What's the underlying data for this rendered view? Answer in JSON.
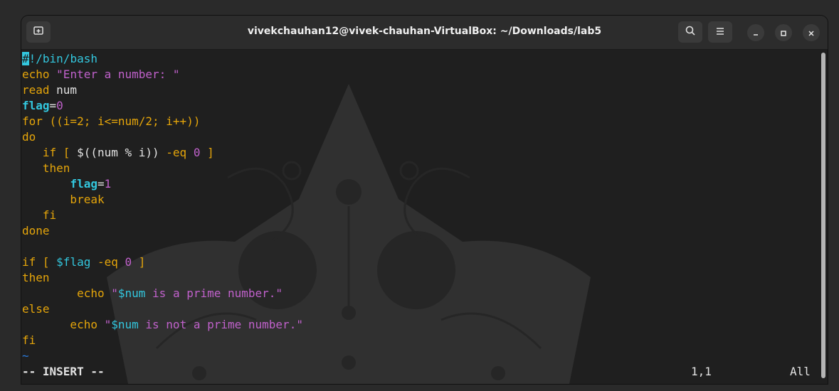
{
  "window": {
    "title": "vivekchauhan12@vivek-chauhan-VirtualBox: ~/Downloads/lab5",
    "new_tab_icon": "new-tab-icon",
    "search_icon": "search-icon",
    "menu_icon": "hamburger-menu-icon",
    "minimize_icon": "minimize-icon",
    "maximize_icon": "maximize-icon",
    "close_icon": "close-icon"
  },
  "editor": {
    "mode": "-- INSERT --",
    "position": "1,1",
    "scroll": "All",
    "empty_line_marker": "~",
    "lines": [
      [
        {
          "t": "#",
          "c": "cursor"
        },
        {
          "t": "!/bin/bash",
          "c": "var"
        }
      ],
      [
        {
          "t": "echo ",
          "c": "kw"
        },
        {
          "t": "\"Enter a number: \"",
          "c": "str"
        }
      ],
      [
        {
          "t": "read",
          "c": "kw"
        },
        {
          "t": " num",
          "c": "plain"
        }
      ],
      [
        {
          "t": "flag",
          "c": "var bold"
        },
        {
          "t": "=",
          "c": "plain"
        },
        {
          "t": "0",
          "c": "str"
        }
      ],
      [
        {
          "t": "for ((i=2; i<=num/2; i++))",
          "c": "kw"
        }
      ],
      [
        {
          "t": "do",
          "c": "kw"
        }
      ],
      [
        {
          "t": "   if [ ",
          "c": "kw"
        },
        {
          "t": "$((num % i))",
          "c": "plain"
        },
        {
          "t": " -eq ",
          "c": "kw"
        },
        {
          "t": "0",
          "c": "str"
        },
        {
          "t": " ]",
          "c": "kw"
        }
      ],
      [
        {
          "t": "   then",
          "c": "kw"
        }
      ],
      [
        {
          "t": "       ",
          "c": "plain"
        },
        {
          "t": "flag",
          "c": "var bold"
        },
        {
          "t": "=",
          "c": "plain"
        },
        {
          "t": "1",
          "c": "str"
        }
      ],
      [
        {
          "t": "       break",
          "c": "kw"
        }
      ],
      [
        {
          "t": "   fi",
          "c": "kw"
        }
      ],
      [
        {
          "t": "done",
          "c": "kw"
        }
      ],
      [
        {
          "t": "",
          "c": "plain"
        }
      ],
      [
        {
          "t": "if [ ",
          "c": "kw"
        },
        {
          "t": "$flag",
          "c": "var"
        },
        {
          "t": " -eq ",
          "c": "kw"
        },
        {
          "t": "0",
          "c": "str"
        },
        {
          "t": " ]",
          "c": "kw"
        }
      ],
      [
        {
          "t": "then",
          "c": "kw"
        }
      ],
      [
        {
          "t": "        echo ",
          "c": "kw"
        },
        {
          "t": "\"",
          "c": "str"
        },
        {
          "t": "$num",
          "c": "var"
        },
        {
          "t": " is a prime number.\"",
          "c": "str"
        }
      ],
      [
        {
          "t": "else",
          "c": "kw"
        }
      ],
      [
        {
          "t": "       echo ",
          "c": "kw"
        },
        {
          "t": "\"",
          "c": "str"
        },
        {
          "t": "$num",
          "c": "var"
        },
        {
          "t": " is not a prime number.\"",
          "c": "str"
        }
      ],
      [
        {
          "t": "fi",
          "c": "kw"
        }
      ]
    ]
  }
}
